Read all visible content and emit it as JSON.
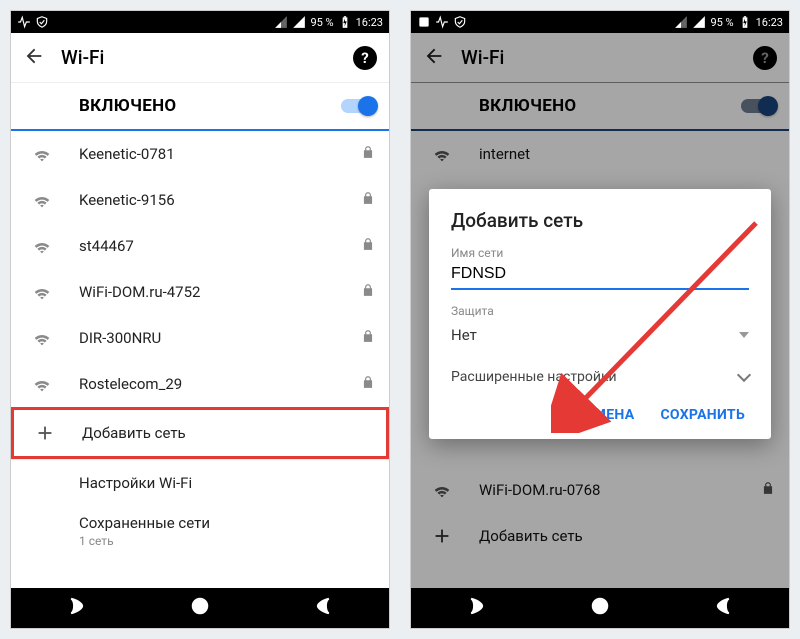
{
  "status": {
    "battery": "95 %",
    "time": "16:23"
  },
  "left": {
    "title": "Wi-Fi",
    "toggle_label": "ВКЛЮЧЕНО",
    "networks": [
      {
        "ssid": "Keenetic-0781",
        "locked": true
      },
      {
        "ssid": "Keenetic-9156",
        "locked": true
      },
      {
        "ssid": "st44467",
        "locked": true
      },
      {
        "ssid": "WiFi-DOM.ru-4752",
        "locked": true
      },
      {
        "ssid": "DIR-300NRU",
        "locked": true
      },
      {
        "ssid": "Rostelecom_29",
        "locked": true
      }
    ],
    "add_network": "Добавить сеть",
    "settings": "Настройки Wi-Fi",
    "saved": "Сохраненные сети",
    "saved_sub": "1 сеть"
  },
  "right": {
    "title": "Wi-Fi",
    "toggle_label": "ВКЛЮЧЕНО",
    "bg_networks": [
      {
        "ssid": "internet"
      },
      {
        "ssid": "WiFi-DOM.ru-0768"
      }
    ],
    "bg_add": "Добавить сеть",
    "dialog": {
      "title": "Добавить сеть",
      "ssid_label": "Имя сети",
      "ssid_value": "FDNSD",
      "security_label": "Защита",
      "security_value": "Нет",
      "advanced": "Расширенные настройки",
      "cancel": "ОТМЕНА",
      "save": "СОХРАНИТЬ"
    }
  }
}
